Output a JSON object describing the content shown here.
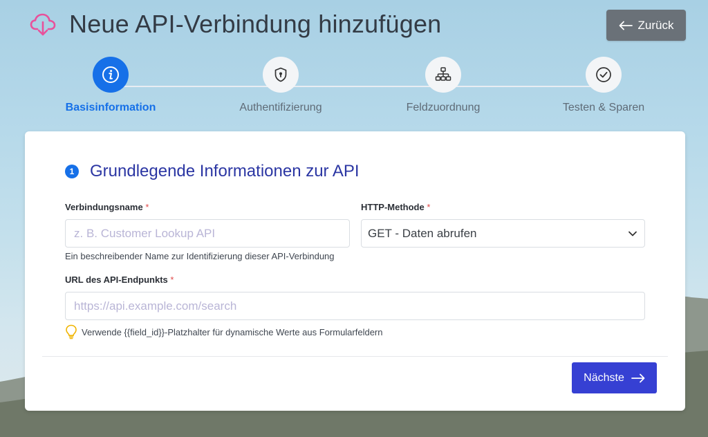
{
  "header": {
    "title": "Neue API-Verbindung hinzufügen",
    "back_label": "Zurück"
  },
  "steps": [
    {
      "label": "Basisinformation",
      "icon": "info-icon",
      "active": true
    },
    {
      "label": "Authentifizierung",
      "icon": "shield-lock-icon",
      "active": false
    },
    {
      "label": "Feldzuordnung",
      "icon": "sitemap-icon",
      "active": false
    },
    {
      "label": "Testen & Sparen",
      "icon": "check-circle-icon",
      "active": false
    }
  ],
  "form": {
    "section_number": "1",
    "section_title": "Grundlegende Informationen zur API",
    "connection_name": {
      "label": "Verbindungsname",
      "required_mark": "*",
      "placeholder": "z. B. Customer Lookup API",
      "value": "",
      "help": "Ein beschreibender Name zur Identifizierung dieser API-Verbindung"
    },
    "http_method": {
      "label": "HTTP-Methode",
      "required_mark": "*",
      "selected": "GET - Daten abrufen"
    },
    "endpoint_url": {
      "label": "URL des API-Endpunkts",
      "required_mark": "*",
      "placeholder": "https://api.example.com/search",
      "value": "",
      "hint": "Verwende {{field_id}}-Platzhalter für dynamische Werte aus Formularfeldern"
    },
    "next_label": "Nächste"
  },
  "colors": {
    "primary": "#1670e8",
    "button": "#3640d3",
    "heading": "#2b36a3",
    "back_button": "#6a7178",
    "required": "#e04b4b",
    "logo": "#e8519b"
  }
}
